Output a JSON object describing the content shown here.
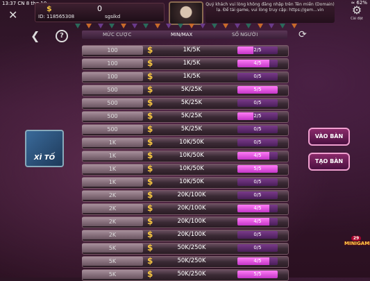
{
  "status_bar": {
    "time": "13:37  CN 8 thg 10",
    "battery": "≈ 62%"
  },
  "player": {
    "coins": "0",
    "id_label": "ID: 118565308",
    "name": "sgsikd"
  },
  "notice_text": "Quý khách vui lòng không đăng nhập trên Tên miền (Domain) lạ. Để tải game, vui lòng truy cập: https://gem…vin",
  "settings_label": "Cài đặt",
  "headers": {
    "bet": "MỨC CƯỢC",
    "minmax": "MIN/MAX",
    "players": "SỐ NGƯỜI"
  },
  "rows": [
    {
      "bet": "100",
      "minmax": "1K/5K",
      "players": "2/5",
      "fill": 0.4
    },
    {
      "bet": "100",
      "minmax": "1K/5K",
      "players": "4/5",
      "fill": 0.8
    },
    {
      "bet": "100",
      "minmax": "1K/5K",
      "players": "0/5",
      "fill": 0
    },
    {
      "bet": "500",
      "minmax": "5K/25K",
      "players": "5/5",
      "fill": 1
    },
    {
      "bet": "500",
      "minmax": "5K/25K",
      "players": "0/5",
      "fill": 0
    },
    {
      "bet": "500",
      "minmax": "5K/25K",
      "players": "2/5",
      "fill": 0.4
    },
    {
      "bet": "500",
      "minmax": "5K/25K",
      "players": "0/5",
      "fill": 0
    },
    {
      "bet": "1K",
      "minmax": "10K/50K",
      "players": "0/5",
      "fill": 0
    },
    {
      "bet": "1K",
      "minmax": "10K/50K",
      "players": "4/5",
      "fill": 0.8
    },
    {
      "bet": "1K",
      "minmax": "10K/50K",
      "players": "5/5",
      "fill": 1
    },
    {
      "bet": "1K",
      "minmax": "10K/50K",
      "players": "0/5",
      "fill": 0
    },
    {
      "bet": "2K",
      "minmax": "20K/100K",
      "players": "0/5",
      "fill": 0
    },
    {
      "bet": "2K",
      "minmax": "20K/100K",
      "players": "4/5",
      "fill": 0.8
    },
    {
      "bet": "2K",
      "minmax": "20K/100K",
      "players": "4/5",
      "fill": 0.8
    },
    {
      "bet": "2K",
      "minmax": "20K/100K",
      "players": "0/5",
      "fill": 0
    },
    {
      "bet": "5K",
      "minmax": "50K/250K",
      "players": "0/5",
      "fill": 0
    },
    {
      "bet": "5K",
      "minmax": "50K/250K",
      "players": "4/5",
      "fill": 0.8
    },
    {
      "bet": "5K",
      "minmax": "50K/250K",
      "players": "5/5",
      "fill": 1
    }
  ],
  "game_label": "XÌ TỐ",
  "buttons": {
    "join": "VÀO BÀN",
    "create": "TẠO BÀN"
  },
  "minigame": {
    "badge": "29",
    "label": "MINIGAME"
  },
  "icons": {
    "close": "close-icon",
    "back": "back-icon",
    "help": "help-icon",
    "refresh": "refresh-icon",
    "gear": "gear-icon",
    "dollar": "dollar-icon"
  },
  "colors": {
    "fill": "#ff7cf6",
    "coin": "#f5c542",
    "bg": "#3a1832"
  }
}
